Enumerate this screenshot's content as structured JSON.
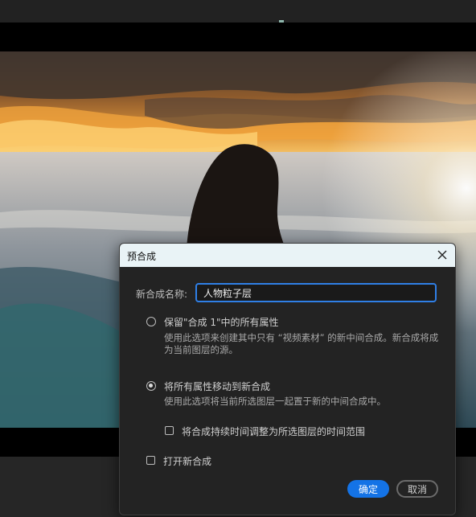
{
  "dialog": {
    "title": "预合成",
    "name_label": "新合成名称:",
    "name_value": "人物粒子层",
    "option_keep": {
      "label": "保留\"合成 1\"中的所有属性",
      "description": "使用此选项来创建其中只有 “视频素材” 的新中间合成。新合成将成为当前图层的源。",
      "selected": false
    },
    "option_move": {
      "label": "将所有属性移动到新合成",
      "description": "使用此选项将当前所选图层一起置于新的中间合成中。",
      "selected": true
    },
    "adjust_duration": {
      "label": "将合成持续时间调整为所选图层的时间范围",
      "checked": false
    },
    "open_new": {
      "label": "打开新合成",
      "checked": false
    },
    "ok_label": "确定",
    "cancel_label": "取消"
  },
  "colors": {
    "accent": "#1473e6",
    "title_bar": "#e9f3f6",
    "dialog_bg": "#232323"
  },
  "icons": {
    "close": "close-icon"
  }
}
